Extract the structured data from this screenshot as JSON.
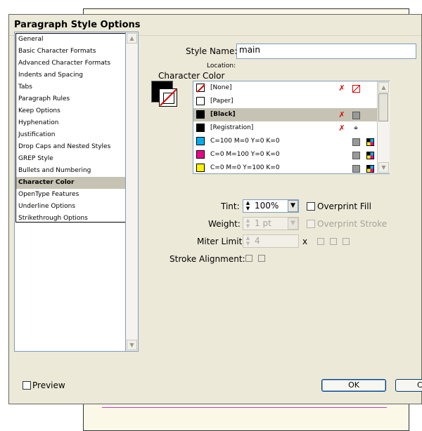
{
  "dialog": {
    "title": "Paragraph Style Options"
  },
  "categories": [
    "General",
    "Basic Character Formats",
    "Advanced Character Formats",
    "Indents and Spacing",
    "Tabs",
    "Paragraph Rules",
    "Keep Options",
    "Hyphenation",
    "Justification",
    "Drop Caps and Nested Styles",
    "GREP Style",
    "Bullets and Numbering",
    "Character Color",
    "OpenType Features",
    "Underline Options",
    "Strikethrough Options"
  ],
  "selected_category": "Character Color",
  "style_name": {
    "label": "Style Name:",
    "value": "main"
  },
  "location": {
    "label": "Location:"
  },
  "section_title": "Character Color",
  "swatches": [
    {
      "name": "[None]",
      "color": "none"
    },
    {
      "name": "[Paper]",
      "color": "#ffffff"
    },
    {
      "name": "[Black]",
      "color": "#000000",
      "selected": true
    },
    {
      "name": "[Registration]",
      "color": "#000000"
    },
    {
      "name": "C=100 M=0 Y=0 K=0",
      "color": "#00aeef"
    },
    {
      "name": "C=0 M=100 Y=0 K=0",
      "color": "#ec008c"
    },
    {
      "name": "C=0 M=0 Y=100 K=0",
      "color": "#fff200"
    }
  ],
  "tint": {
    "label": "Tint:",
    "value": "100%"
  },
  "overprint_fill": {
    "label": "Overprint Fill"
  },
  "weight": {
    "label": "Weight:",
    "value": "1 pt"
  },
  "overprint_stroke": {
    "label": "Overprint Stroke"
  },
  "miter_limit": {
    "label": "Miter Limit:",
    "value": "4",
    "unit": "x"
  },
  "stroke_alignment": {
    "label": "Stroke Alignment:"
  },
  "preview": {
    "label": "Preview"
  },
  "ok_button": "OK",
  "cancel_button": "Ca"
}
